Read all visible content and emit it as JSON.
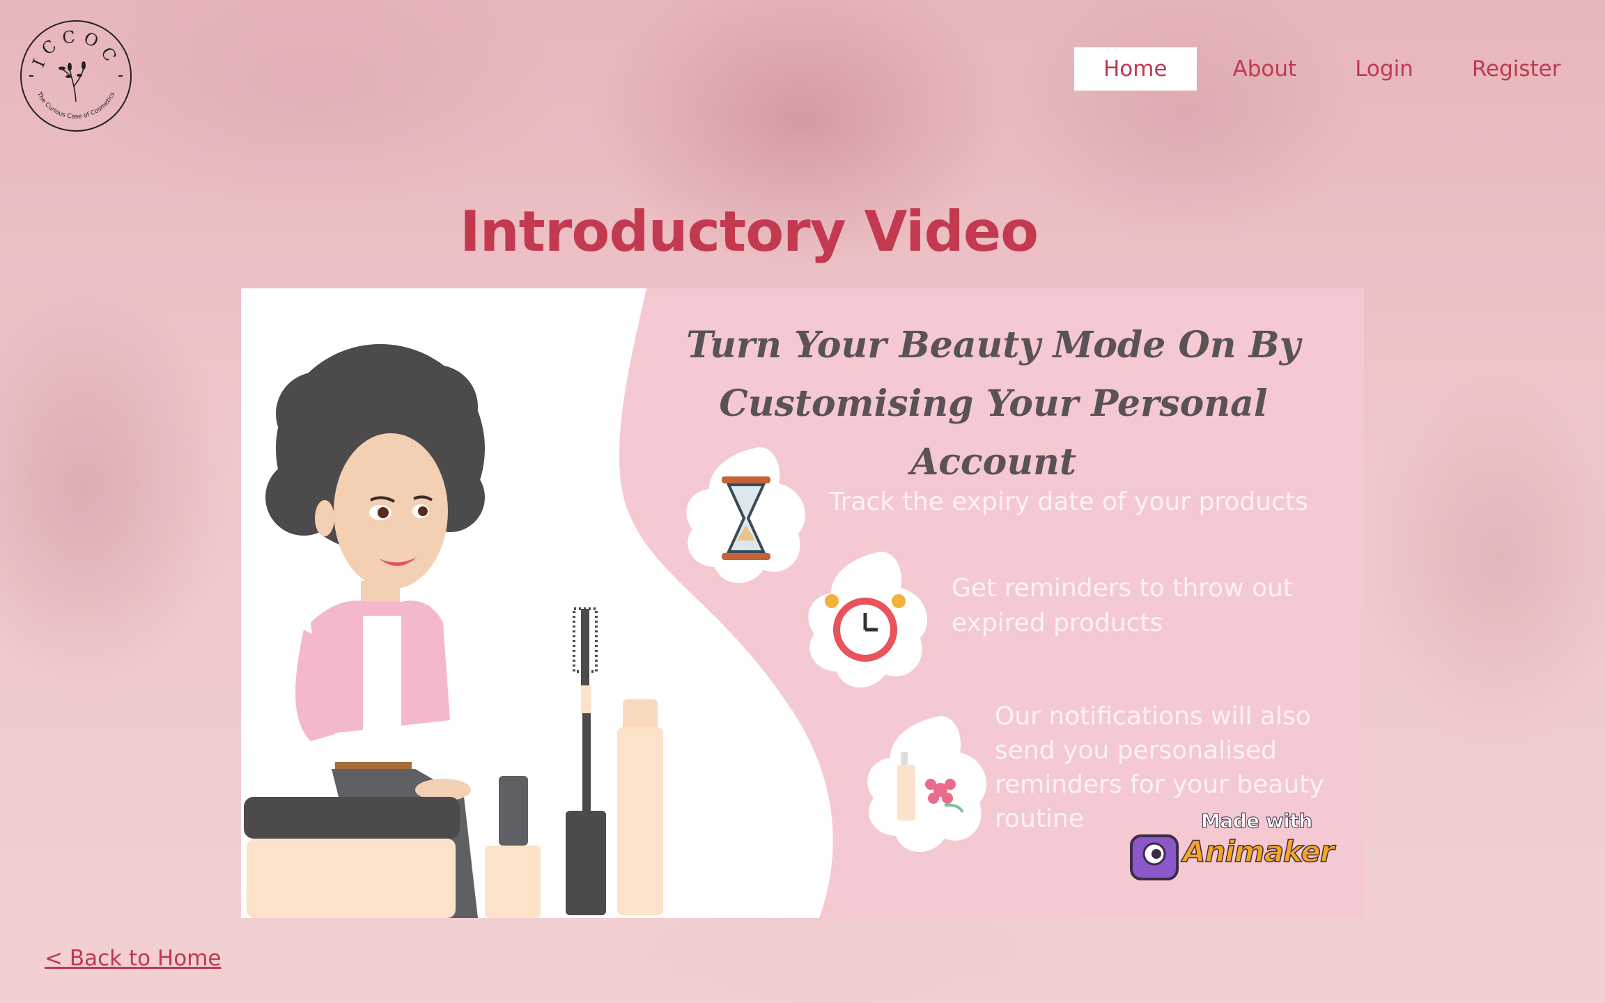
{
  "logo": {
    "text": "ICCOC",
    "tagline": "The Curious Case of Cosmetics"
  },
  "nav": {
    "items": [
      {
        "label": "Home",
        "active": true
      },
      {
        "label": "About",
        "active": false
      },
      {
        "label": "Login",
        "active": false
      },
      {
        "label": "Register",
        "active": false
      }
    ]
  },
  "page": {
    "title": "Introductory Video"
  },
  "video": {
    "headline_line1": "Turn Your Beauty Mode On By",
    "headline_line2": "Customising Your Personal Account",
    "features": [
      {
        "text": "Track the expiry date of your products",
        "icon": "hourglass-icon"
      },
      {
        "text": "Get reminders to throw out expired products",
        "icon": "alarm-clock-icon"
      },
      {
        "text": "Our notifications will also send you personalised reminders for your beauty routine",
        "icon": "lotion-flower-icon"
      }
    ],
    "badge_top": "Made with",
    "badge_brand": "Animaker"
  },
  "footer": {
    "back_link": "< Back to Home"
  },
  "colors": {
    "accent": "#c0394f",
    "video_pink": "#f5c9d1",
    "nav_active_bg": "#ffffff"
  }
}
